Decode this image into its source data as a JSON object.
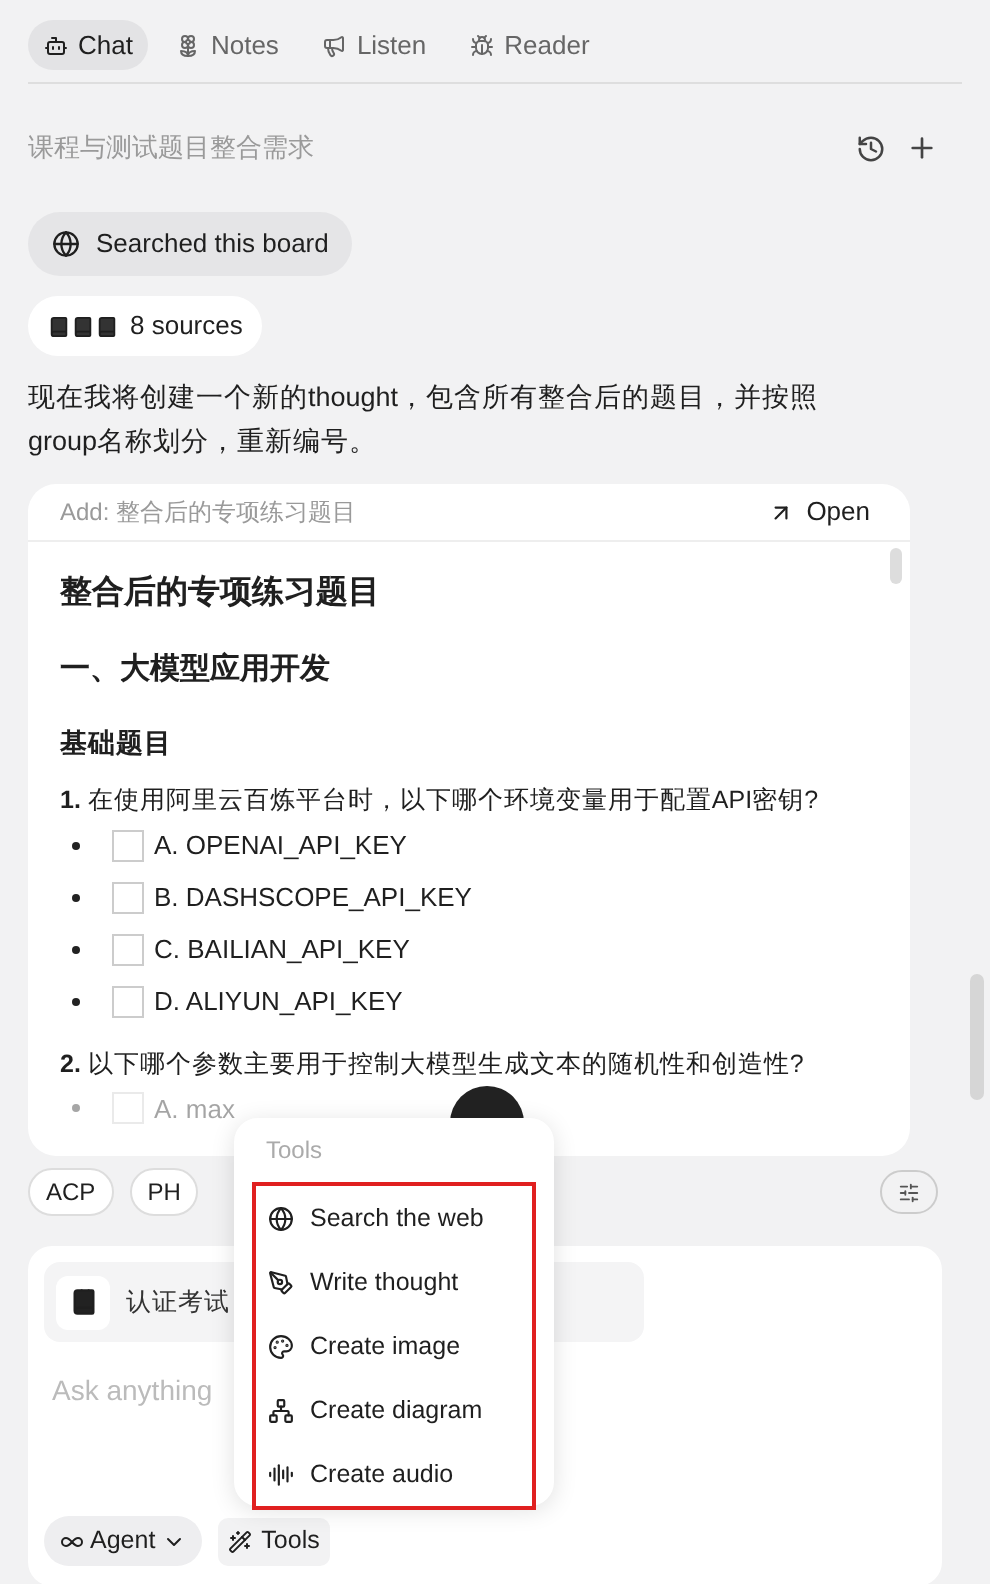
{
  "tabs": [
    {
      "label": "Chat",
      "selected": true
    },
    {
      "label": "Notes",
      "selected": false
    },
    {
      "label": "Listen",
      "selected": false
    },
    {
      "label": "Reader",
      "selected": false
    }
  ],
  "conversation_title": "课程与测试题目整合需求",
  "search_chip": {
    "label": "Searched this board"
  },
  "sources": {
    "label": "8 sources"
  },
  "message": "现在我将创建一个新的thought，包含所有整合后的题目，并按照group名称划分，重新编号。",
  "preview_card": {
    "header": "Add: 整合后的专项练习题目",
    "open_label": "Open",
    "title": "整合后的专项练习题目",
    "section": "一、大模型应用开发",
    "subsection": "基础题目",
    "questions": [
      {
        "number": "1.",
        "text": "在使用阿里云百炼平台时，以下哪个环境变量用于配置API密钥?",
        "options": [
          {
            "label": "A. OPENAI_API_KEY",
            "checked": false,
            "faded": false
          },
          {
            "label": "B. DASHSCOPE_API_KEY",
            "checked": false,
            "faded": false
          },
          {
            "label": "C. BAILIAN_API_KEY",
            "checked": false,
            "faded": false
          },
          {
            "label": "D. ALIYUN_API_KEY",
            "checked": false,
            "faded": false
          }
        ]
      },
      {
        "number": "2.",
        "text": "以下哪个参数主要用于控制大模型生成文本的随机性和创造性?",
        "options": [
          {
            "label": "A. max",
            "checked": false,
            "faded": true
          }
        ]
      }
    ]
  },
  "quick_chips": [
    "ACP",
    "PH"
  ],
  "composer": {
    "attachment": "认证考试",
    "placeholder": "Ask anything",
    "mode": "Agent",
    "tools_label": "Tools"
  },
  "tools_menu": {
    "heading": "Tools",
    "items": [
      "Search the web",
      "Write thought",
      "Create image",
      "Create diagram",
      "Create audio"
    ]
  }
}
